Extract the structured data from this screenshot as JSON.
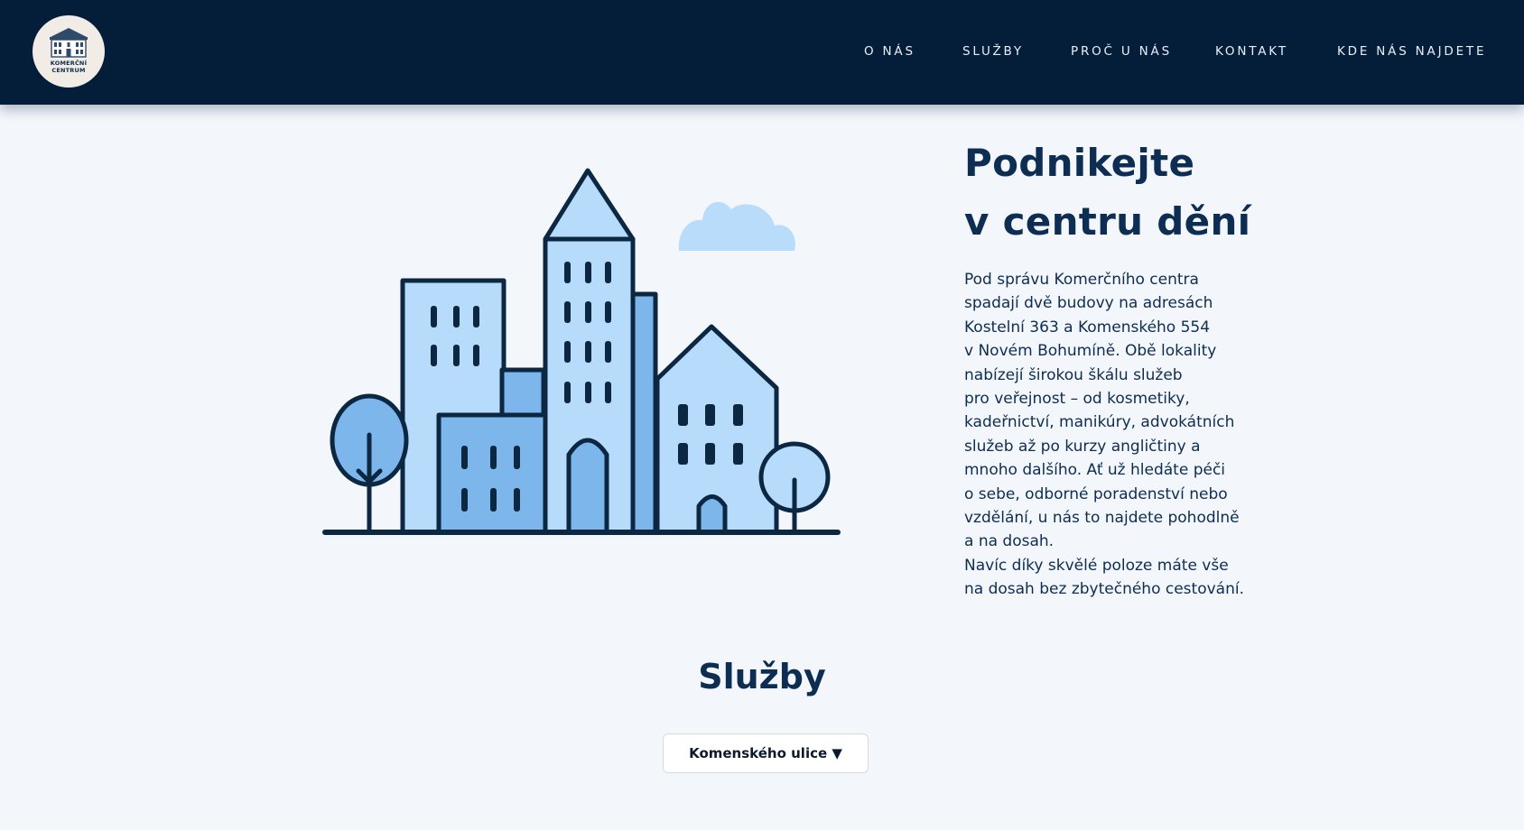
{
  "logo": {
    "line1": "KOMERČNÍ",
    "line2": "CENTRUM"
  },
  "nav": {
    "items": [
      {
        "label": "O NÁS"
      },
      {
        "label": "SLUŽBY"
      },
      {
        "label": "PROČ U NÁS"
      },
      {
        "label": "KONTAKT"
      },
      {
        "label": "KDE NÁS NAJDETE"
      }
    ]
  },
  "hero": {
    "title_line1": "Podnikejte",
    "title_line2": "v centru dění",
    "text_lines": [
      "Pod správu Komerčního centra",
      "spadají dvě budovy na adresách",
      "Kostelní 363 a Komenského 554",
      "v Novém Bohumíně. Obě lokality",
      "nabízejí širokou škálu služeb",
      "pro veřejnost – od kosmetiky,",
      "kadeřnictví, manikúry, advokátních",
      "služeb až po kurzy angličtiny a",
      "mnoho dalšího. Ať už hledáte péči",
      "o sebe, odborné poradenství nebo",
      "vzdělání, u nás to najdete pohodlně",
      "a na dosah.",
      "Navíc díky skvělé poloze máte vše",
      "na dosah bez zbytečného cestování."
    ]
  },
  "services": {
    "title": "Služby",
    "select_value": "Komenského ulice ▼"
  },
  "colors": {
    "navbar": "#041e3a",
    "heading": "#0d2d52",
    "background": "#f3f6fb",
    "building_light": "#b7dbfb",
    "building_mid": "#7db6ea",
    "outline": "#0c2742"
  }
}
